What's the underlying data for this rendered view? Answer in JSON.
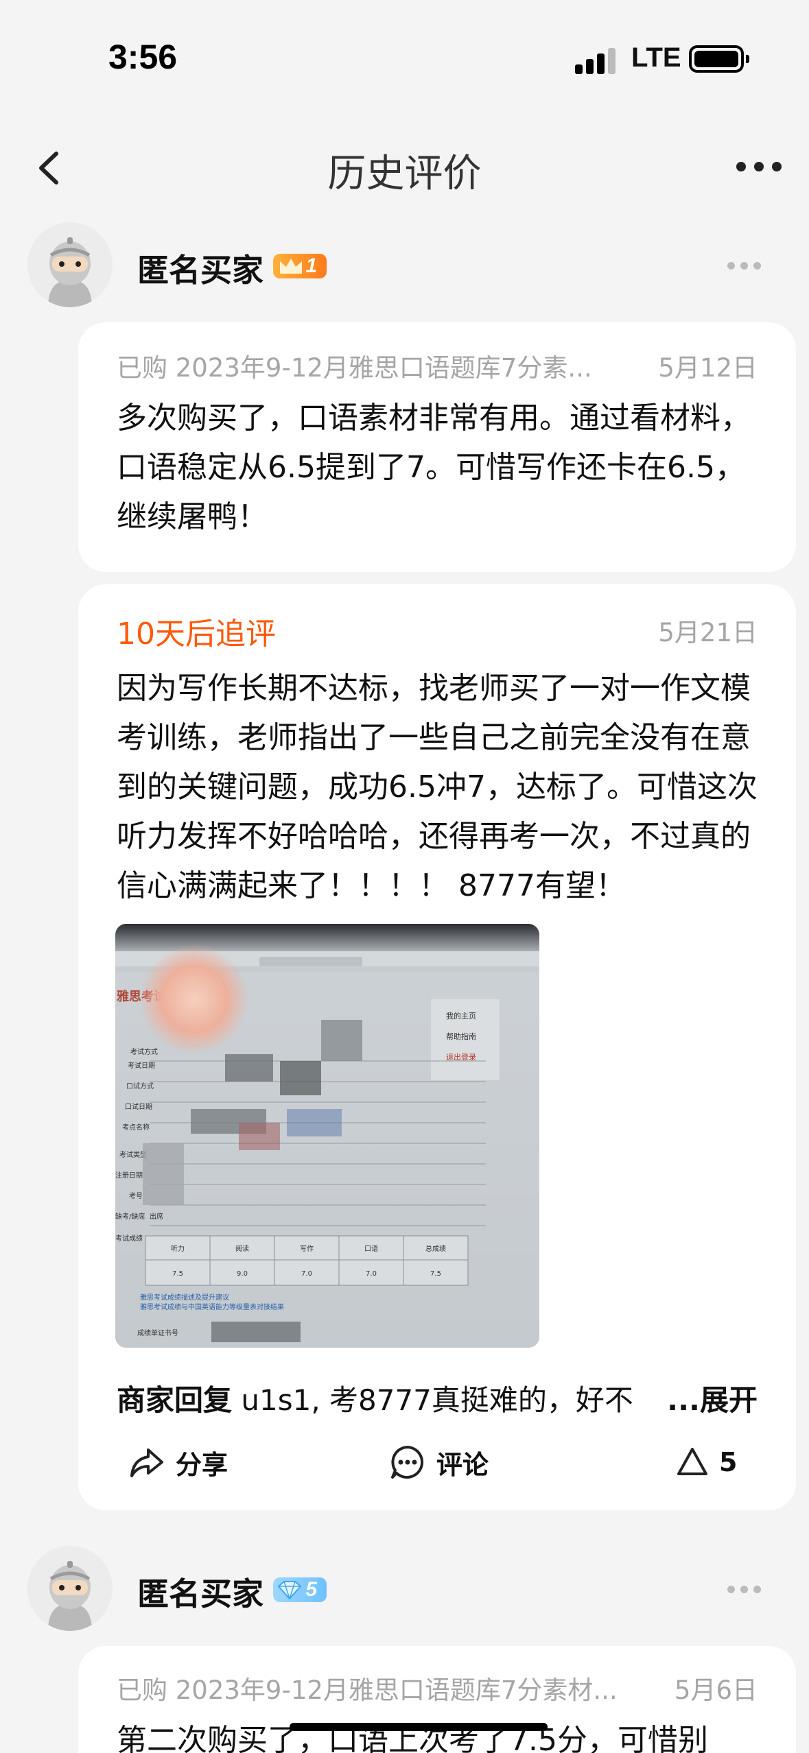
{
  "status_bar": {
    "time": "3:56",
    "network": "LTE"
  },
  "nav": {
    "title": "历史评价"
  },
  "reviews": [
    {
      "user_name": "匿名买家",
      "badge_level": "1",
      "badge_type": "crown",
      "purchased": "已购 2023年9-12月雅思口语题库7分素...",
      "date": "5月12日",
      "text": "多次购买了，口语素材非常有用。通过看材料，口语稳定从6.5提到了7。可惜写作还卡在6.5，继续屠鸭！",
      "followup": {
        "title": "10天后追评",
        "date": "5月21日",
        "text": "因为写作长期不达标，找老师买了一对一作文模考训练，老师指出了一些自己之前完全没有在意到的关键问题，成功6.5冲7，达标了。可惜这次听力发挥不好哈哈哈，还得再考一次，不过真的信心满满起来了！！！！ 8777有望！"
      },
      "photo": {
        "site_title": "雅思考试报名网站",
        "side_menu": [
          "我的主页",
          "帮助指南",
          "退出登录"
        ],
        "row_labels": [
          "考试方式",
          "考试日期",
          "口试方式",
          "口试日期",
          "考点名称",
          "考试类型",
          "注册日期",
          "考号",
          "缺考/缺席",
          "考试成绩"
        ],
        "status_value": "出席",
        "score_headers": [
          "听力",
          "阅读",
          "写作",
          "口语",
          "总成绩"
        ],
        "score_values": [
          "7.5",
          "9.0",
          "7.0",
          "7.0",
          "7.5"
        ],
        "links": [
          "雅思考试成绩描述及提升建议",
          "雅思考试成绩与中国英语能力等级量表对接结果"
        ],
        "footer": "成绩单证书号"
      },
      "merchant_reply": {
        "label": "商家回复",
        "text": "u1s1, 考8777真挺难的，好不",
        "expand": "...展开"
      },
      "actions": {
        "share": "分享",
        "comment": "评论",
        "like_count": "5"
      }
    },
    {
      "user_name": "匿名买家",
      "badge_level": "5",
      "badge_type": "diamond",
      "purchased": "已购 2023年9-12月雅思口语题库7分素材...",
      "date": "5月6日",
      "text": "第二次购买了，口语上次考了7.5分，可惜别"
    }
  ],
  "colors": {
    "accent": "#ff5a0a",
    "background": "#f4f4f4",
    "card": "#ffffff",
    "muted": "#a5a5a5"
  },
  "icons": [
    "back-icon",
    "more-icon",
    "share-icon",
    "comment-icon",
    "like-icon",
    "crown-icon",
    "diamond-icon"
  ]
}
